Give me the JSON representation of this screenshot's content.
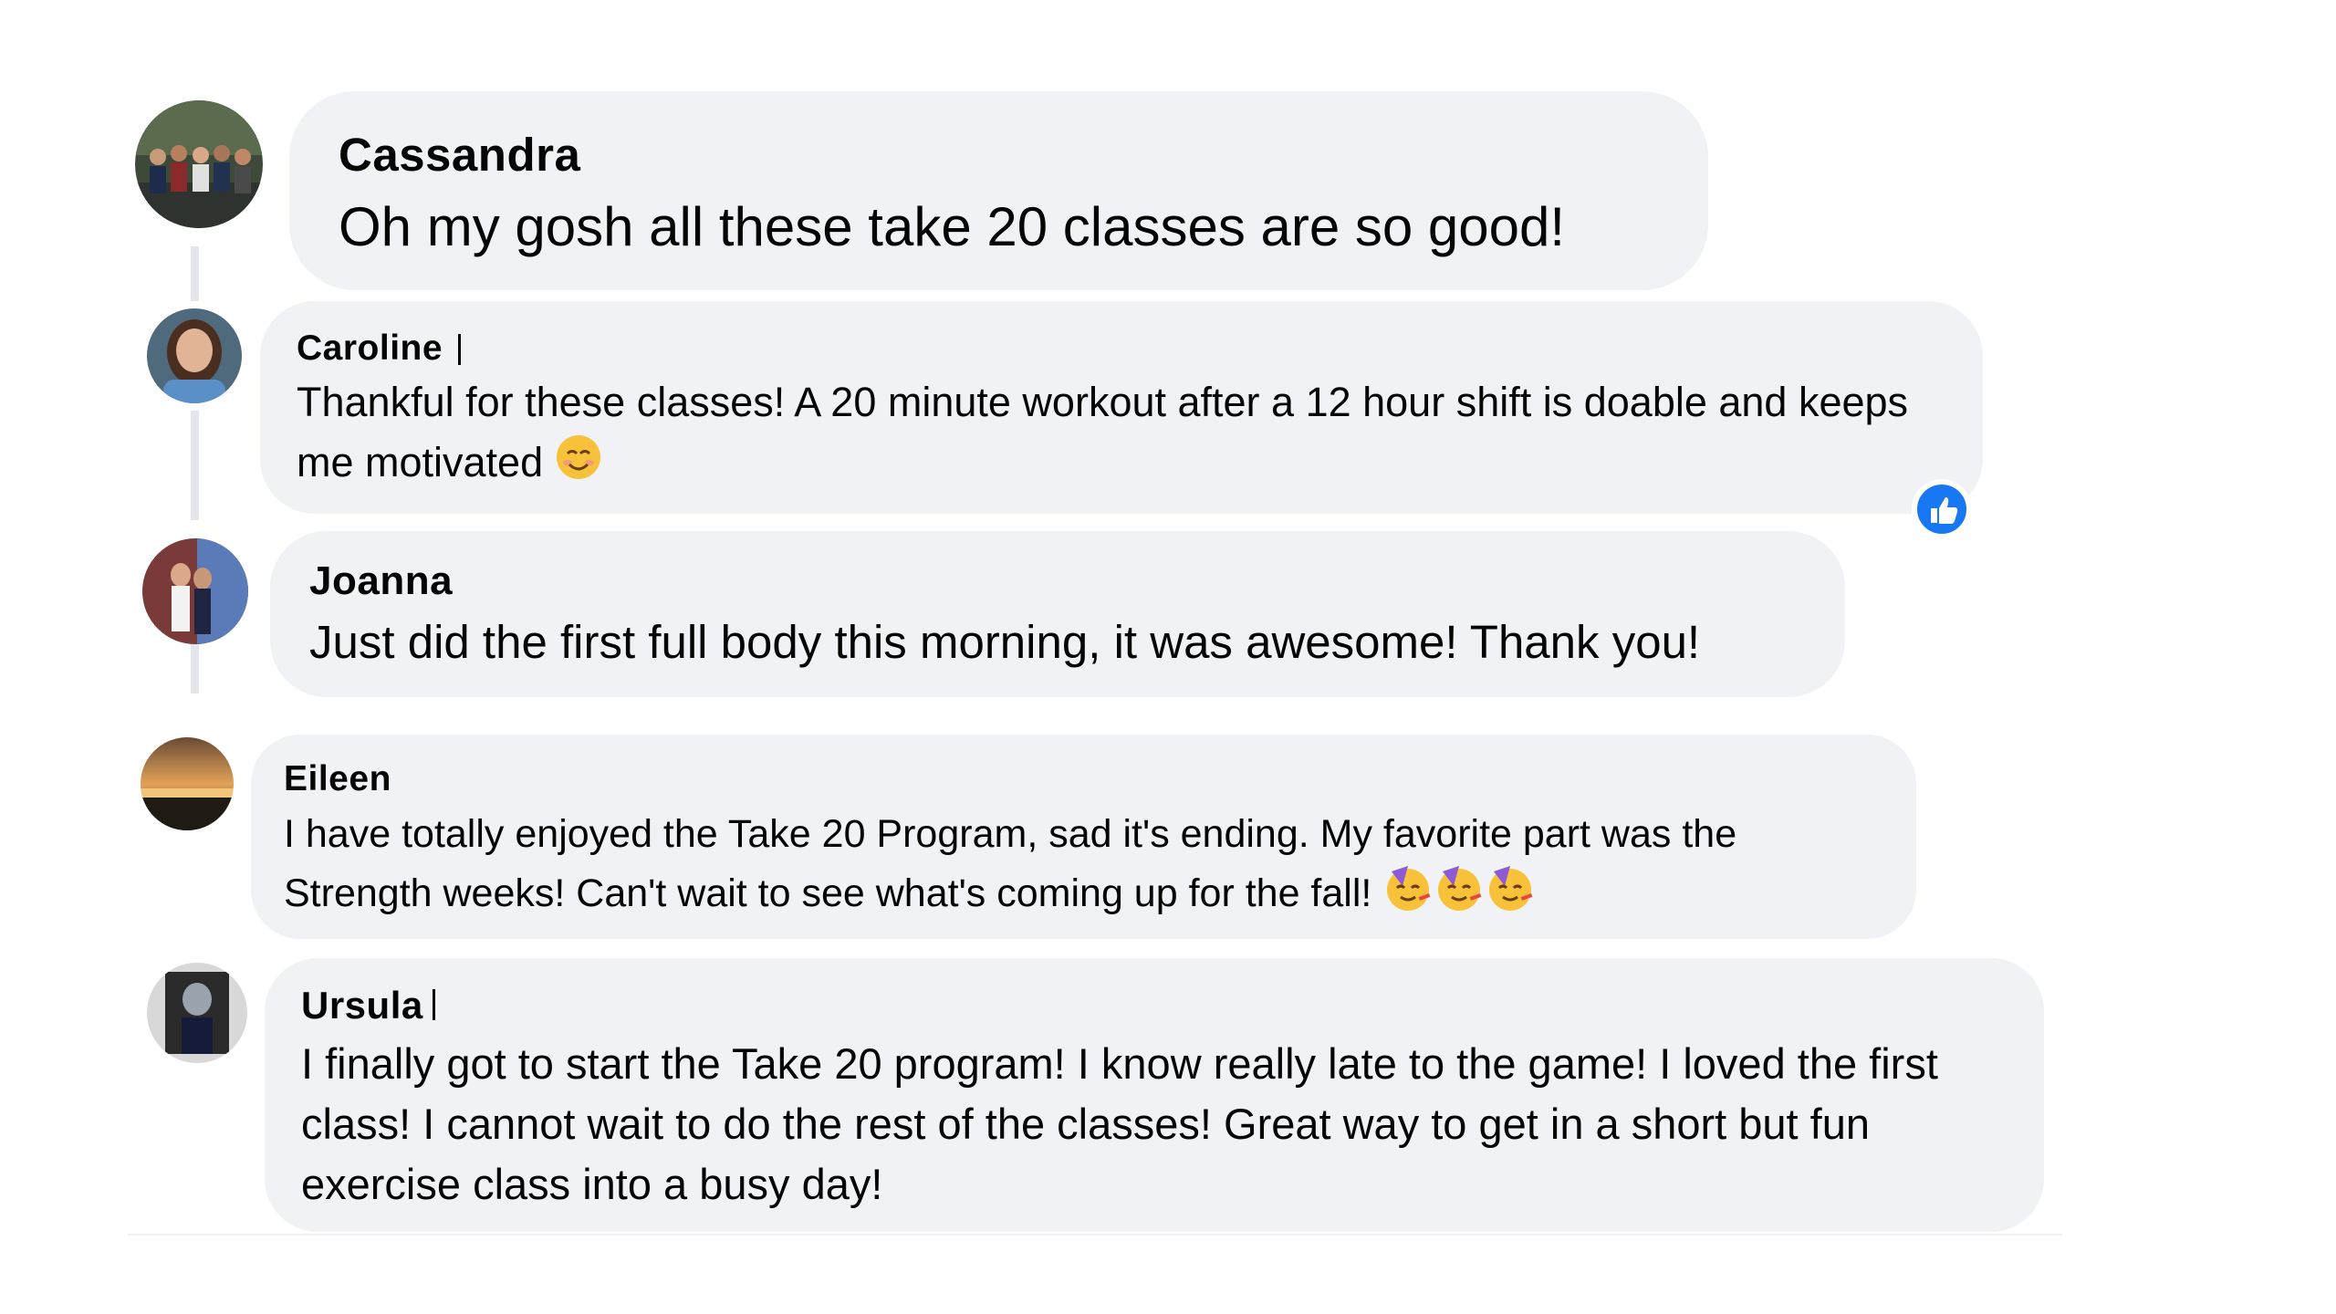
{
  "comments": [
    {
      "author": "Cassandra",
      "text": "Oh my gosh all these take 20 classes are so good!"
    },
    {
      "author": "Caroline",
      "text": "Thankful for these classes! A 20 minute workout after a 12 hour shift is doable and keeps me motivated",
      "emoji": "smiling-face-icon",
      "reaction": "like-icon"
    },
    {
      "author": "Joanna",
      "text": "Just did the first full body this morning, it was awesome! Thank you!"
    },
    {
      "author": "Eileen",
      "text": "I have totally enjoyed the Take 20 Program, sad it's ending. My favorite part was the Strength weeks! Can't wait to see what's coming up for the fall!",
      "emoji": "partying-face-icon"
    },
    {
      "author": "Ursula",
      "text": "I finally got to start the Take 20 program! I know really late to the game! I loved the first class! I cannot wait to do the rest of the classes! Great way to get in a short but fun exercise class into a busy day!"
    }
  ],
  "colors": {
    "bubble": "#f0f2f5",
    "text": "#050505",
    "thread": "#e4e6eb",
    "like": "#1877f2"
  }
}
